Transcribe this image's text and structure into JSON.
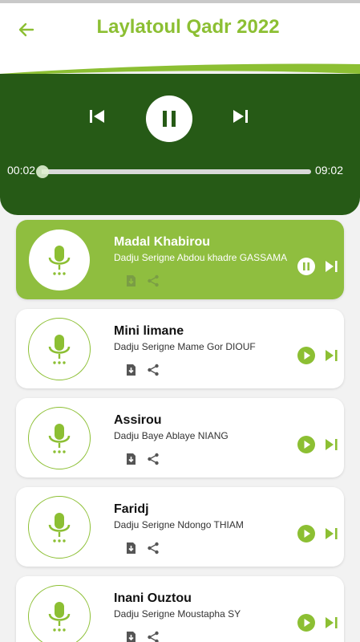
{
  "app": {
    "title": "Laylatoul Qadr 2022",
    "accent": "#8cbf33",
    "player_bg": "#265a16"
  },
  "player": {
    "current_time": "00:02",
    "total_time": "09:02",
    "progress": 0.004,
    "state": "playing"
  },
  "tracks": [
    {
      "title": "Madal Khabirou",
      "artist": "Dadju Serigne Abdou khadre GASSAMA",
      "active": true,
      "status_icon": "pause-icon"
    },
    {
      "title": "Mini limane",
      "artist": "Dadju Serigne Mame Gor DIOUF",
      "active": false,
      "status_icon": "play-icon"
    },
    {
      "title": "Assirou",
      "artist": "Dadju Baye Ablaye NIANG",
      "active": false,
      "status_icon": "play-icon"
    },
    {
      "title": "Faridj",
      "artist": "Dadju Serigne Ndongo THIAM",
      "active": false,
      "status_icon": "play-icon"
    },
    {
      "title": "Inani Ouztou",
      "artist": "Dadju Serigne Moustapha SY",
      "active": false,
      "status_icon": "play-icon"
    }
  ]
}
